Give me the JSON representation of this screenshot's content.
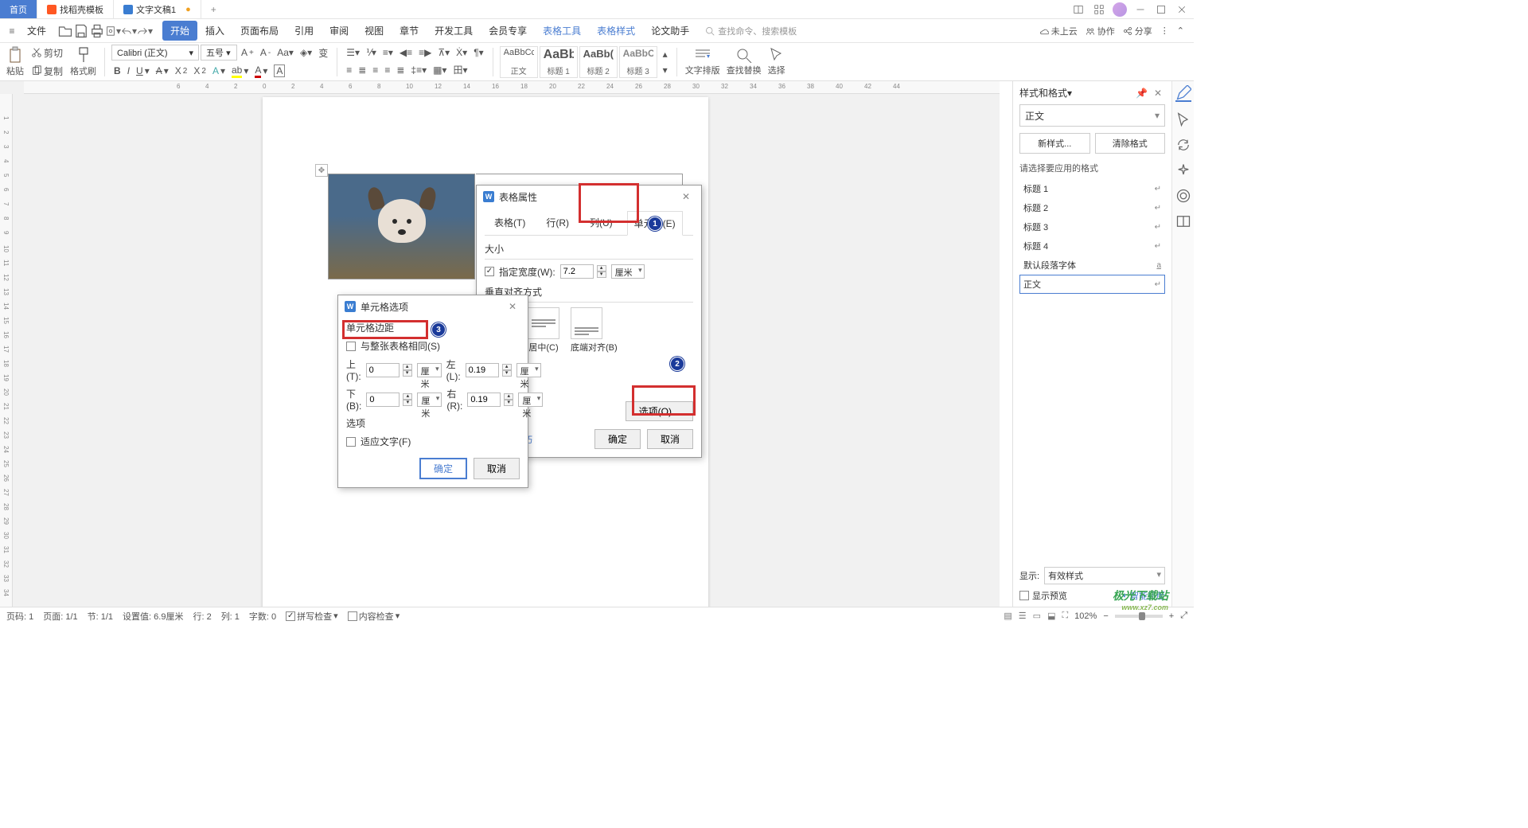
{
  "titlebar": {
    "tabs": [
      {
        "label": "首页"
      },
      {
        "label": "找稻壳模板"
      },
      {
        "label": "文字文稿1"
      }
    ],
    "plus": "+"
  },
  "menu": {
    "file": "文件",
    "tabs": [
      "开始",
      "插入",
      "页面布局",
      "引用",
      "审阅",
      "视图",
      "章节",
      "开发工具",
      "会员专享",
      "表格工具",
      "表格样式",
      "论文助手"
    ],
    "search_prompt": "查找命令、搜索模板",
    "right": {
      "cloud": "未上云",
      "collab": "协作",
      "share": "分享"
    }
  },
  "ribbon": {
    "paste": "粘贴",
    "cut": "剪切",
    "copy": "复制",
    "format_painter": "格式刷",
    "font_name": "Calibri (正文)",
    "font_size": "五号",
    "layout": "文字排版",
    "findrep": "查找替换",
    "select": "选择",
    "styles": [
      {
        "preview": "AaBbCcD",
        "name": "正文"
      },
      {
        "preview": "AaBb",
        "name": "标题 1"
      },
      {
        "preview": "AaBb(",
        "name": "标题 2"
      },
      {
        "preview": "AaBbC(",
        "name": "标题 3"
      }
    ]
  },
  "dialog1": {
    "title": "表格属性",
    "tabs": {
      "table": "表格(T)",
      "row": "行(R)",
      "col": "列(U)",
      "cell": "单元格(E)"
    },
    "size_label": "大小",
    "spec_width": "指定宽度(W):",
    "width_val": "7.2",
    "unit": "厘米",
    "valign_label": "垂直对齐方式",
    "valign_center": "居中(C)",
    "valign_bottom": "底端对齐(B)",
    "options_btn": "选项(O)...",
    "tip": "操作技巧",
    "ok": "确定",
    "cancel": "取消"
  },
  "dialog2": {
    "title": "单元格选项",
    "margin_label": "单元格边距",
    "same_as_table": "与整张表格相同(S)",
    "top": "上(T):",
    "bottom": "下(B):",
    "left": "左(L):",
    "right": "右(R):",
    "val_tb": "0",
    "val_lr": "0.19",
    "unit": "厘米",
    "options_label": "选项",
    "fit_text": "适应文字(F)",
    "ok": "确定",
    "cancel": "取消"
  },
  "sidepanel": {
    "title": "样式和格式",
    "current_style": "正文",
    "new_style": "新样式...",
    "clear": "清除格式",
    "choose_label": "请选择要应用的格式",
    "list": [
      "标题 1",
      "标题 2",
      "标题 3",
      "标题 4",
      "默认段落字体",
      "正文"
    ],
    "show_label": "显示:",
    "show_value": "有效样式",
    "preview_check": "显示预览",
    "smart": "智能排版"
  },
  "status": {
    "page_no": "页码: 1",
    "page": "页面: 1/1",
    "sec": "节: 1/1",
    "setval": "设置值: 6.9厘米",
    "row": "行: 2",
    "col": "列: 1",
    "chars": "字数: 0",
    "spell": "拼写检查",
    "content": "内容检查",
    "zoom": "102%"
  },
  "watermark": {
    "main": "极光下载站",
    "sub": "www.xz7.com"
  }
}
